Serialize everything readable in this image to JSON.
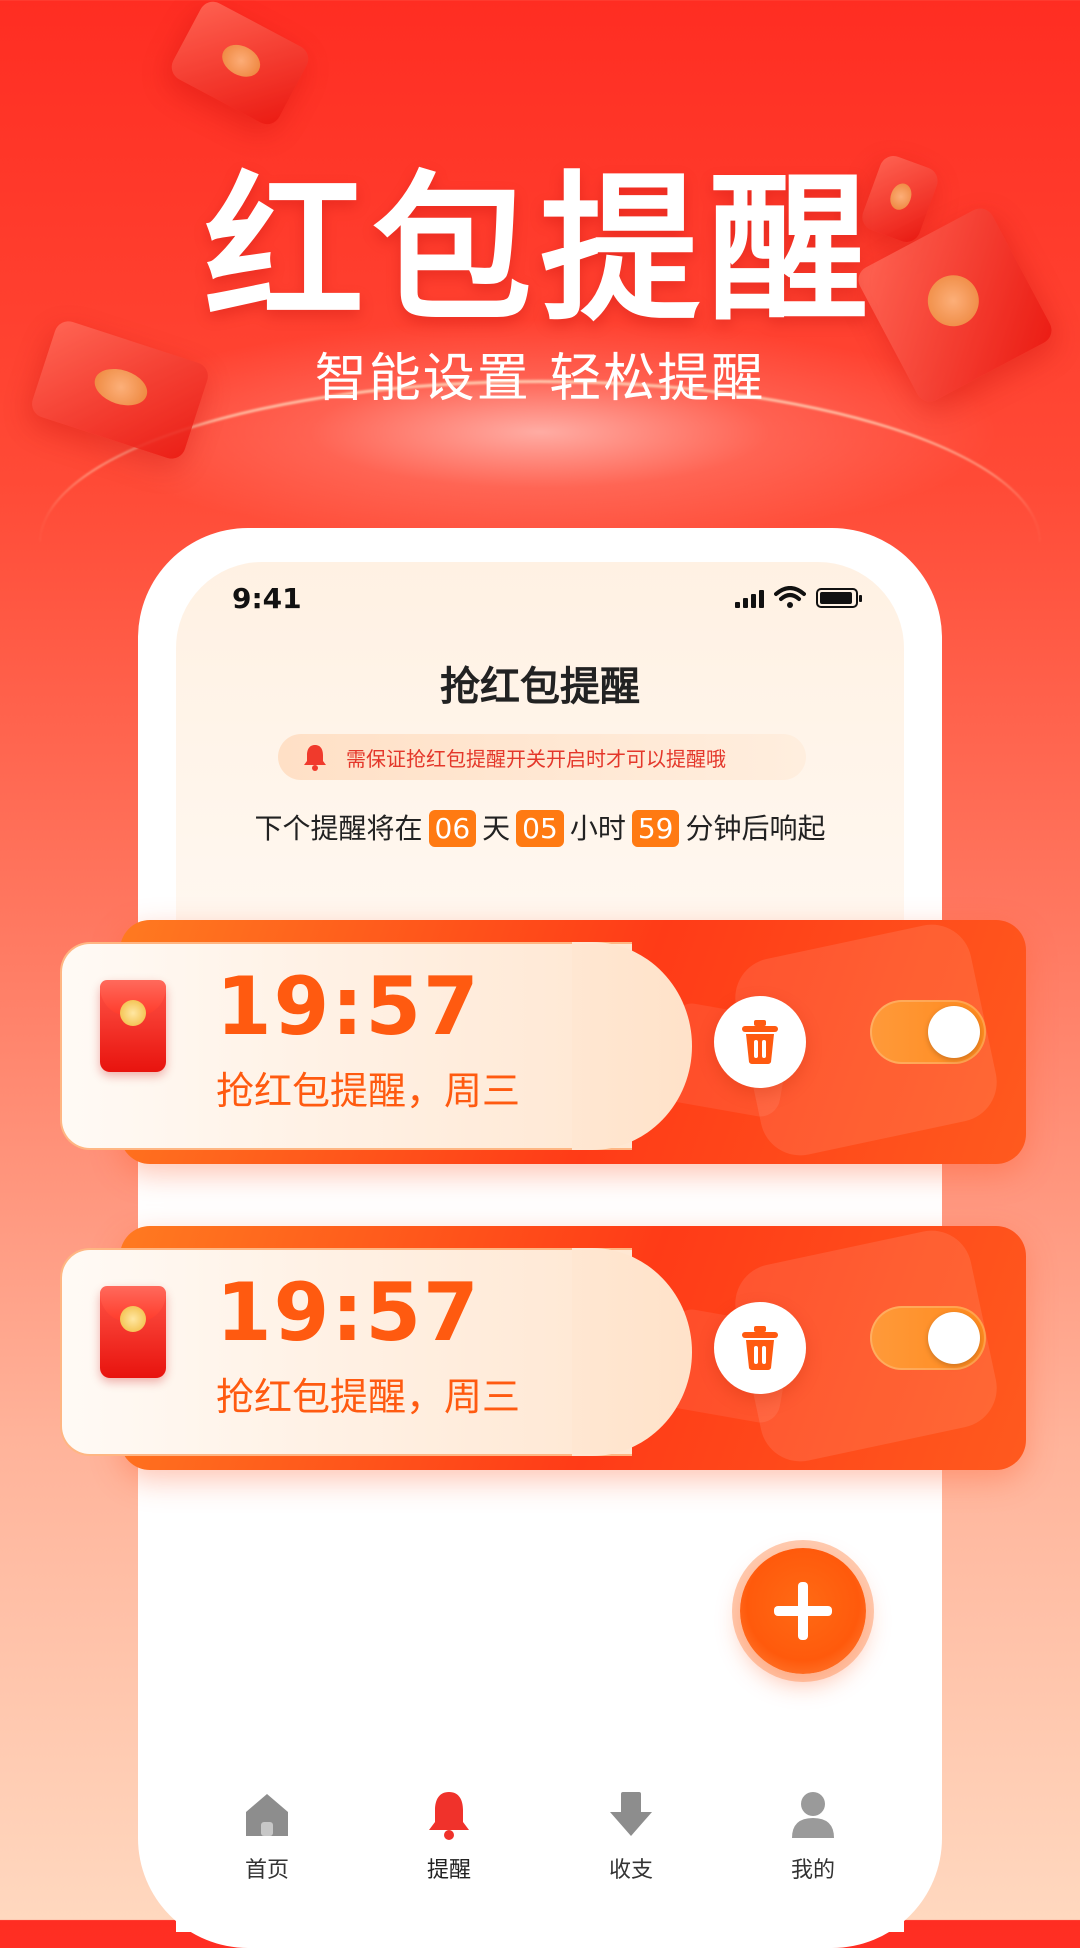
{
  "hero": {
    "title": "红包提醒",
    "subtitle": "智能设置 轻松提醒"
  },
  "status_bar": {
    "time": "9:41"
  },
  "screen": {
    "title": "抢红包提醒",
    "notice": "需保证抢红包提醒开关开启时才可以提醒哦",
    "countdown": {
      "prefix": "下个提醒将在",
      "days": "06",
      "days_unit": "天",
      "hours": "05",
      "hours_unit": "小时",
      "minutes": "59",
      "suffix": "分钟后响起"
    }
  },
  "reminders": [
    {
      "time": "19:57",
      "label": "抢红包提醒，周三",
      "enabled": true
    },
    {
      "time": "19:57",
      "label": "抢红包提醒，周三",
      "enabled": true
    }
  ],
  "nav": {
    "items": [
      {
        "label": "首页",
        "icon": "home-icon"
      },
      {
        "label": "提醒",
        "icon": "bell-icon"
      },
      {
        "label": "收支",
        "icon": "download-icon"
      },
      {
        "label": "我的",
        "icon": "user-icon"
      }
    ],
    "active_index": 1
  },
  "colors": {
    "accent": "#ff5a10",
    "brand_red": "#ff2d22",
    "toggle_on": "#ff8a1e"
  }
}
